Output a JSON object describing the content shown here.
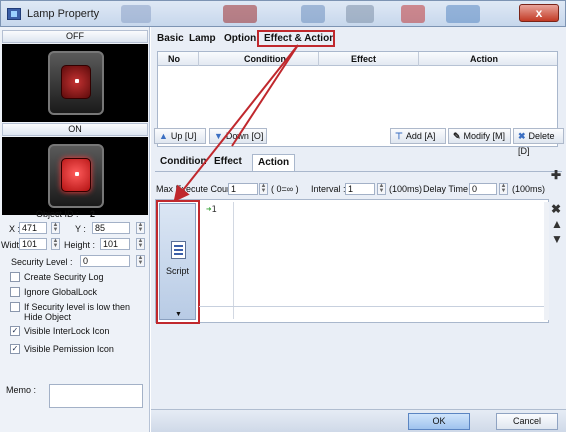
{
  "window": {
    "title": "Lamp Property",
    "close_label": "x"
  },
  "left": {
    "off_label": "OFF",
    "on_label": "ON",
    "object_id_label": "Object ID :",
    "object_id": "2",
    "x_label": "X :",
    "x_value": "471",
    "y_label": "Y :",
    "y_value": "85",
    "width_label": "Width :",
    "width_value": "101",
    "height_label": "Height :",
    "height_value": "101",
    "security_label": "Security Level :",
    "security_value": "0",
    "checkboxes": [
      {
        "label": "Create Security Log",
        "checked": false
      },
      {
        "label": "Ignore GlobalLock",
        "checked": false
      },
      {
        "label": "If Security level is low then",
        "checked": false
      },
      {
        "label": "Hide Object",
        "checked": false
      },
      {
        "label": "Visible InterLock Icon",
        "checked": true
      },
      {
        "label": "Visible Pemission Icon",
        "checked": true
      }
    ],
    "memo_label": "Memo :"
  },
  "tabs": [
    "Basic",
    "Lamp",
    "Option",
    "Effect & Action"
  ],
  "grid": {
    "columns": [
      "No",
      "Condition",
      "Effect",
      "Action"
    ]
  },
  "toolbar": {
    "up": "Up [U]",
    "down": "Down [O]",
    "add": "Add [A]",
    "modify": "Modify [M]",
    "delete": "Delete [D]"
  },
  "subtabs": [
    "Condition",
    "Effect",
    "Action"
  ],
  "params": {
    "max_execute_label": "Max Execute Count :",
    "max_execute_value": "1",
    "max_execute_hint": "( 0=∞ )",
    "interval_label": "Interval :",
    "interval_value": "1",
    "interval_unit": "(100ms)",
    "delay_label": "Delay Time :",
    "delay_value": "0",
    "delay_unit": "(100ms)"
  },
  "editor": {
    "script_label": "Script",
    "line_number": "1"
  },
  "footer": {
    "ok": "OK",
    "cancel": "Cancel"
  },
  "colors": {
    "highlight": "#c0282d",
    "ok_button": "#9fc3ee",
    "lamp_on": "#ff3a3a"
  }
}
